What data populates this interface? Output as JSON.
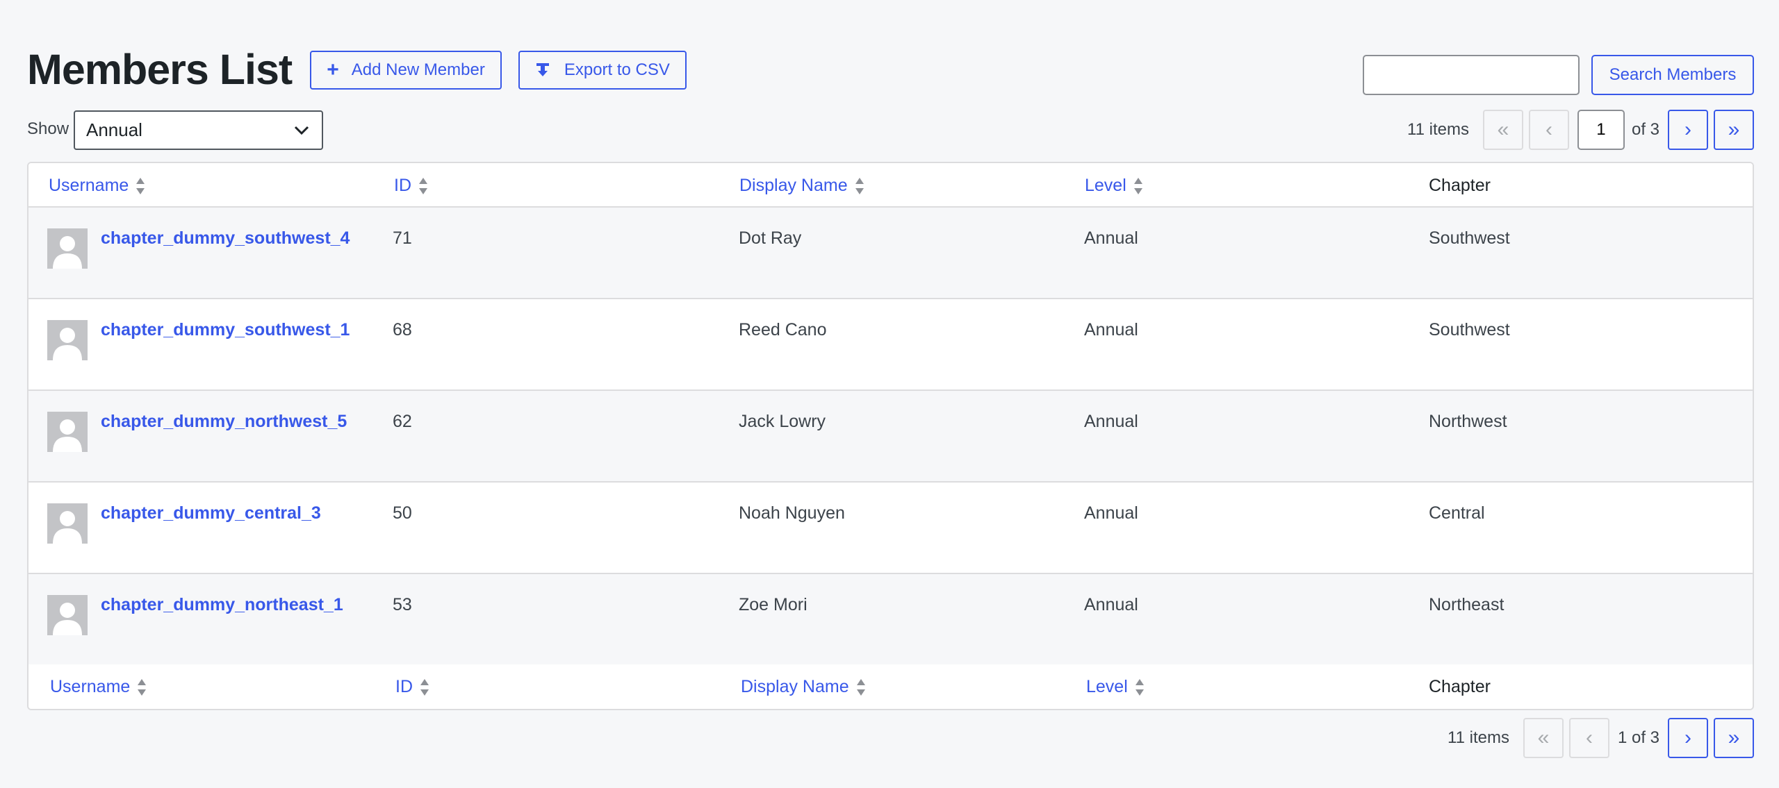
{
  "page": {
    "title": "Members List",
    "add_button": "Add New Member",
    "export_button": "Export to CSV"
  },
  "search": {
    "value": "",
    "button": "Search Members"
  },
  "filter": {
    "label": "Show",
    "selected": "Annual"
  },
  "pagination": {
    "items": "11 items",
    "first": "«",
    "prev": "‹",
    "next": "›",
    "last": "»",
    "current_page": "1",
    "of_pages": "of 3",
    "bottom_text": "1 of 3"
  },
  "columns": {
    "username": "Username",
    "id": "ID",
    "display_name": "Display Name",
    "level": "Level",
    "chapter": "Chapter"
  },
  "members": [
    {
      "username": "chapter_dummy_southwest_4",
      "id": "71",
      "display_name": "Dot Ray",
      "level": "Annual",
      "chapter": "Southwest"
    },
    {
      "username": "chapter_dummy_southwest_1",
      "id": "68",
      "display_name": "Reed Cano",
      "level": "Annual",
      "chapter": "Southwest"
    },
    {
      "username": "chapter_dummy_northwest_5",
      "id": "62",
      "display_name": "Jack Lowry",
      "level": "Annual",
      "chapter": "Northwest"
    },
    {
      "username": "chapter_dummy_central_3",
      "id": "50",
      "display_name": "Noah Nguyen",
      "level": "Annual",
      "chapter": "Central"
    },
    {
      "username": "chapter_dummy_northeast_1",
      "id": "53",
      "display_name": "Zoe Mori",
      "level": "Annual",
      "chapter": "Northeast"
    }
  ],
  "colors": {
    "accent": "#3858e9",
    "background": "#f6f7f9",
    "text": "#1d2327"
  }
}
